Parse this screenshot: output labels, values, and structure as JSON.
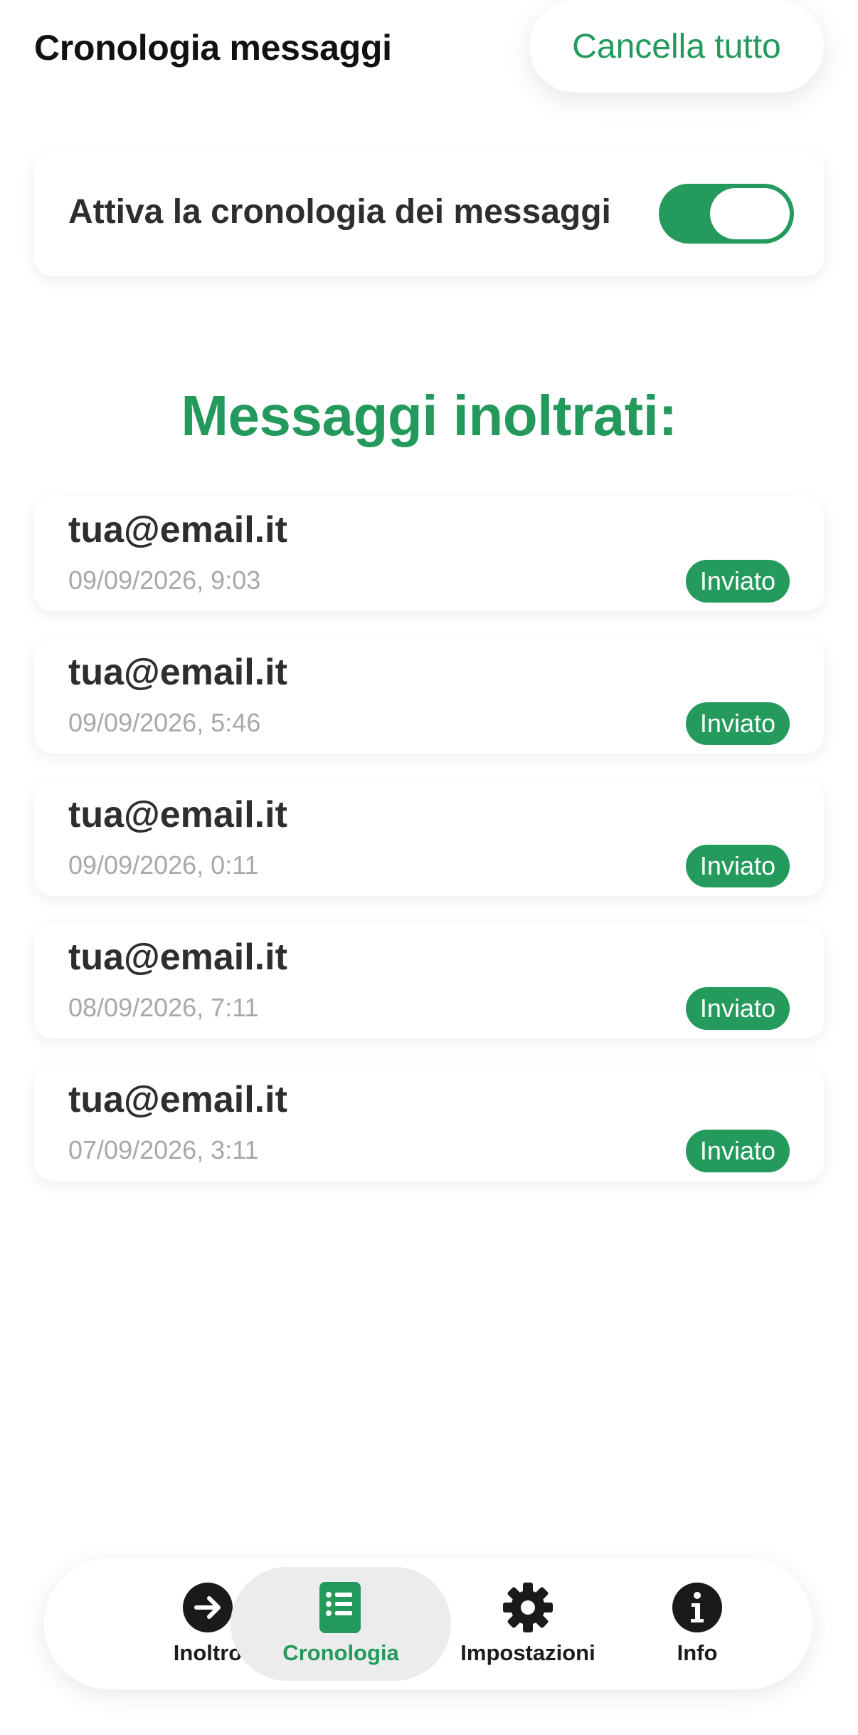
{
  "header": {
    "title": "Cronologia messaggi",
    "clear_label": "Cancella tutto"
  },
  "settings": {
    "history_toggle_label": "Attiva la cronologia dei messaggi",
    "history_enabled": true
  },
  "section_title": "Messaggi inoltrati:",
  "messages": [
    {
      "email": "tua@email.it",
      "datetime": "09/09/2026, 9:03",
      "status": "Inviato"
    },
    {
      "email": "tua@email.it",
      "datetime": "09/09/2026, 5:46",
      "status": "Inviato"
    },
    {
      "email": "tua@email.it",
      "datetime": "09/09/2026, 0:11",
      "status": "Inviato"
    },
    {
      "email": "tua@email.it",
      "datetime": "08/09/2026, 7:11",
      "status": "Inviato"
    },
    {
      "email": "tua@email.it",
      "datetime": "07/09/2026, 3:11",
      "status": "Inviato"
    }
  ],
  "nav": {
    "items": [
      {
        "label": "Inoltro",
        "icon": "arrow-right-circle-icon",
        "active": false
      },
      {
        "label": "Cronologia",
        "icon": "list-document-icon",
        "active": true
      },
      {
        "label": "Impostazioni",
        "icon": "gear-icon",
        "active": false
      },
      {
        "label": "Info",
        "icon": "info-icon",
        "active": false
      }
    ]
  },
  "colors": {
    "accent": "#239a5c",
    "text": "#2e2e2e",
    "muted": "#a8a8a8"
  }
}
